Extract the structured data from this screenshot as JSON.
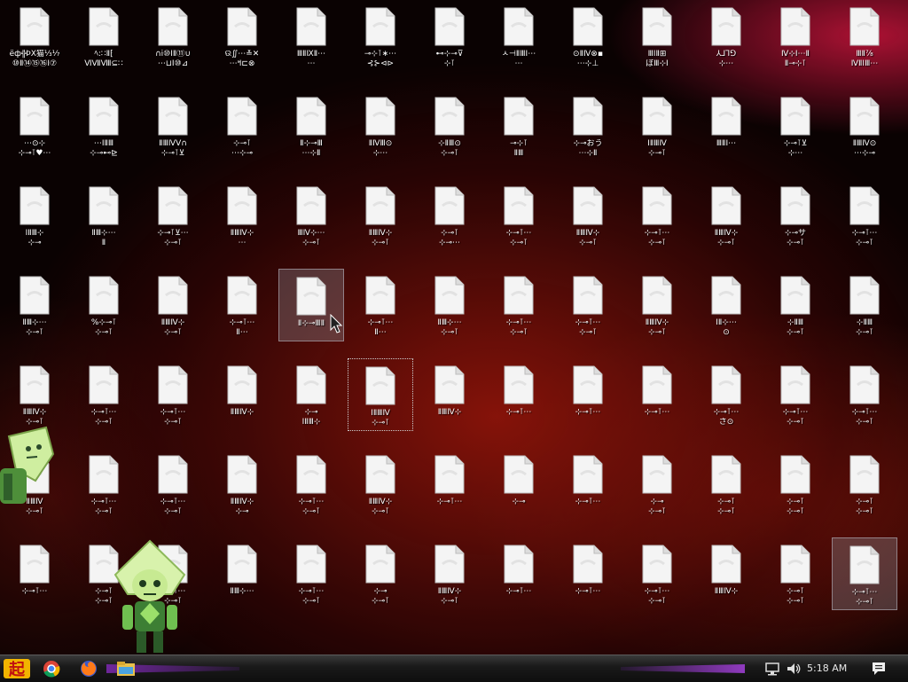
{
  "desktop": {
    "columns": 13,
    "rows": 7,
    "selected_index": 90,
    "focused_index": 57,
    "hover_index": 43,
    "icons": [
      [
        "ёф╬ÞⅩ猫⅓⅐",
        "⑩Ⅱ⑭⑮⑯Ⅰ⑦"
      ],
      [
        "ﾍ:∷Ⅱ⁅",
        "ⅥⅦⅧ⊆∷"
      ],
      [
        "∩ⅰ⑩ⅠⅡ⑪∪",
        "⋯⊔Ⅰ⑩⊿"
      ],
      [
        "ଉ∬⋯≚✕",
        "⋯ߞ⊏⊗"
      ],
      [
        "ⅢⅡⅨⅡ⋯",
        "⋯"
      ],
      [
        "⊸⊹⊺∗⋯",
        "⊰⊱⊲⊳"
      ],
      [
        "⊷⊹⊸⊽",
        "⊹⊺"
      ],
      [
        "ㅅ⊣ⅡⅢⅠ⋯",
        "⋯"
      ],
      [
        "⊙ⅡⅣ⊗▪",
        "⋯⊹⊥"
      ],
      [
        "ⅢⅠⅡ⊞",
        "ぼⅢ⊹Ⅰ"
      ],
      [
        "⅄⅃⅂⅁",
        "⊹⋯"
      ],
      [
        "Ⅳ⊹Ⅰ⋯Ⅱ",
        "Ⅱ⊸⊹⊺"
      ],
      [
        "ⅢⅡ⅞",
        "ⅣⅡⅠⅢ⋯"
      ],
      [
        "⋯⊙⊹",
        "⊹⊸⊺♥⋯"
      ],
      [
        "⋯ⅠⅡⅢ",
        "⊹⊸⊷⊵"
      ],
      [
        "ⅡⅢⅣⅤ∩",
        "⊹⊸⊺⊻"
      ],
      [
        "⊹⊸⊺",
        "⋯⊹⊸"
      ],
      [
        "Ⅱ⊹⊸Ⅲ",
        "⋯⊹Ⅱ"
      ],
      [
        "ⅡⅣⅢ⊙",
        "⊹⋯"
      ],
      [
        "⊹ⅡⅢ⊙",
        "⊹⊸⊺"
      ],
      [
        "⊸⊹⊺",
        "ⅡⅢ"
      ],
      [
        "⊹⊸おう",
        "⋯⊹Ⅱ"
      ],
      [
        "ⅠⅡⅢⅣ",
        "⊹⊸⊺"
      ],
      [
        "ⅢⅡⅠ⋯",
        ""
      ],
      [
        "⊹⊸⊺⊻",
        "⊹⋯"
      ],
      [
        "ⅡⅢⅣ⊙",
        "⋯⊹⊸"
      ],
      [
        "ⅠⅡⅢ⊹",
        "⊹⊸"
      ],
      [
        "ⅡⅢ⊹⋯",
        "Ⅱ"
      ],
      [
        "⊹⊸⊺⊻⋯",
        "⊹⊸⊺"
      ],
      [
        "ⅡⅢⅣ⊹",
        "⋯"
      ],
      [
        "ⅢⅣ⊹⋯",
        "⊹⊸⊺"
      ],
      [
        "ⅡⅢⅣ⊹",
        "⊹⊸⊺"
      ],
      [
        "⊹⊸⊺",
        "⊹⊸⋯"
      ],
      [
        "⊹⊸⊺⋯",
        "⊹⊸⊺"
      ],
      [
        "ⅡⅢⅣ⊹",
        "⊹⊸⊺"
      ],
      [
        "⊹⊸⊺⋯",
        "⊹⊸⊺"
      ],
      [
        "ⅡⅢⅣ⊹",
        "⊹⊸⊺"
      ],
      [
        "⊹⊸サ",
        "⊹⊸⊺"
      ],
      [
        "⊹⊸⊺⋯",
        "⊹⊸⊺"
      ],
      [
        "ⅡⅢ⊹⋯",
        "⊹⊸⊺"
      ],
      [
        "%⊹⊸⊺",
        "⊹⊸⊺"
      ],
      [
        "ⅡⅢⅣ⊹",
        "⊹⊸⊺"
      ],
      [
        "⊹⊸⊺⋯",
        "Ⅱ⋯"
      ],
      [
        "Ⅱ⊹⊸ⅢⅡ",
        ""
      ],
      [
        "⊹⊸⊺⋯",
        "Ⅱ⋯"
      ],
      [
        "ⅡⅢ⊹⋯",
        "⊹⊸⊺"
      ],
      [
        "⊹⊸⊺⋯",
        "⊹⊸⊺"
      ],
      [
        "⊹⊸⊺⋯",
        "⊹⊸⊺"
      ],
      [
        "ⅡⅢⅣ⊹",
        "⊹⊸⊺"
      ],
      [
        "ⅠⅡ⊹⋯",
        "⊙"
      ],
      [
        "⊹ⅡⅢ",
        "⊹⊸⊺"
      ],
      [
        "⊹ⅡⅢ",
        "⊹⊸⊺"
      ],
      [
        "ⅡⅢⅣ⊹",
        "⊹⊸⊺"
      ],
      [
        "⊹⊸⊺⋯",
        "⊹⊸⊺"
      ],
      [
        "⊹⊸⊺⋯",
        "⊹⊸⊺"
      ],
      [
        "ⅡⅢⅣ⊹",
        ""
      ],
      [
        "⊹⊸",
        "ⅠⅡⅢ⊹"
      ],
      [
        "ⅠⅡⅢⅣ",
        "⊹⊸⊺"
      ],
      [
        "ⅡⅢⅣ⊹",
        ""
      ],
      [
        "⊹⊸⊺⋯",
        ""
      ],
      [
        "⊹⊸⊺⋯",
        ""
      ],
      [
        "⊹⊸⊺⋯",
        ""
      ],
      [
        "⊹⊸⊺⋯",
        "さ⊙"
      ],
      [
        "⊹⊸⊺⋯",
        "⊹⊸⊺"
      ],
      [
        "⊹⊸⊺⋯",
        "⊹⊸⊺"
      ],
      [
        "ⅡⅢⅣ",
        "⊹⊸⊺"
      ],
      [
        "⊹⊸⊺⋯",
        "⊹⊸⊺"
      ],
      [
        "⊹⊸⊺⋯",
        "⊹⊸⊺"
      ],
      [
        "ⅡⅢⅣ⊹",
        "⊹⊸"
      ],
      [
        "⊹⊸⊺⋯",
        "⊹⊸⊺"
      ],
      [
        "ⅡⅢⅣ⊹",
        "⊹⊸⊺"
      ],
      [
        "⊹⊸⊺⋯",
        ""
      ],
      [
        "⊹⊸",
        ""
      ],
      [
        "⊹⊸⊺⋯",
        ""
      ],
      [
        "⊹⊸",
        "⊹⊸⊺"
      ],
      [
        "⊹⊸⊺",
        "⊹⊸⊺"
      ],
      [
        "⊹⊸⊺",
        "⊹⊸⊺"
      ],
      [
        "⊹⊸⊺",
        "⊹⊸⊺"
      ],
      [
        "⊹⊸⊺⋯",
        ""
      ],
      [
        "⊹⊸⊺",
        "⊹⊸⊺"
      ],
      [
        "⊹⊸⊺⋯",
        "⊹⊸⊺"
      ],
      [
        "ⅡⅢ⊹⋯",
        ""
      ],
      [
        "⊹⊸⊺⋯",
        "⊹⊸⊺"
      ],
      [
        "⊹⊸",
        "⊹⊸⊺"
      ],
      [
        "ⅡⅢⅣ⊹",
        "⊹⊸⊺"
      ],
      [
        "⊹⊸⊺⋯",
        ""
      ],
      [
        "⊹⊸⊺⋯",
        ""
      ],
      [
        "⊹⊸⊺⋯",
        "⊹⊸⊺"
      ],
      [
        "ⅡⅢⅣ⊹",
        ""
      ],
      [
        "⊹⊸⊺",
        "⊹⊸⊺"
      ],
      [
        "⊹⊸⊺⋯",
        "⊹⊸⊺"
      ]
    ]
  },
  "taskbar": {
    "start_icon": "start-logo-icon",
    "apps": [
      {
        "name": "chrome-icon"
      },
      {
        "name": "firefox-icon"
      },
      {
        "name": "file-explorer-icon"
      }
    ],
    "tray": [
      "network-icon",
      "volume-icon",
      "action-center-icon"
    ],
    "clock": "5:18 AM"
  },
  "colors": {
    "wallpaper_base": "#0a0202",
    "wallpaper_red": "#8c140a",
    "taskbar": "#1a1a1a",
    "accent_purple": "#9a3cc8",
    "peridot_green": "#8fd14f"
  }
}
